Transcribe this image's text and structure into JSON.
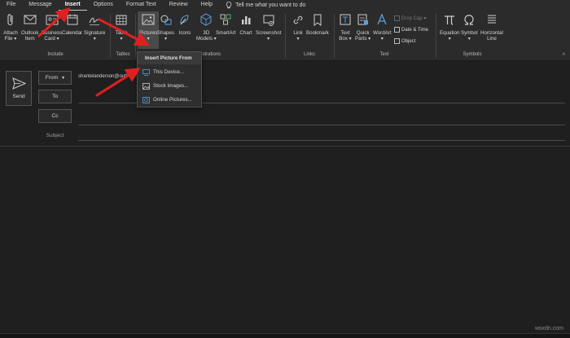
{
  "menu": {
    "tabs": [
      "File",
      "Message",
      "Insert",
      "Options",
      "Format Text",
      "Review",
      "Help"
    ],
    "active_tab": "Insert",
    "tell_me": "Tell me what you want to do"
  },
  "ribbon": {
    "attach_file": [
      "Attach",
      "File ▾"
    ],
    "outlook_item": [
      "Outlook",
      "Item"
    ],
    "business_card": [
      "Business",
      "Card ▾"
    ],
    "calendar": "Calendar",
    "signature": [
      "Signature",
      "▾"
    ],
    "table": [
      "Table",
      "▾"
    ],
    "pictures": [
      "Pictures",
      "▾"
    ],
    "shapes": [
      "Shapes",
      "▾"
    ],
    "icons": "Icons",
    "models_3d": [
      "3D",
      "Models ▾"
    ],
    "smartart": "SmartArt",
    "chart": "Chart",
    "screenshot": [
      "Screenshot",
      "▾"
    ],
    "link": [
      "Link",
      "▾"
    ],
    "bookmark": "Bookmark",
    "text_box": [
      "Text",
      "Box ▾"
    ],
    "quick_parts": [
      "Quick",
      "Parts ▾"
    ],
    "wordart": [
      "WordArt",
      "▾"
    ],
    "drop_cap": "Drop Cap ▾",
    "date_time": "Date & Time",
    "object": "Object",
    "equation": [
      "Equation",
      "▾"
    ],
    "symbol": [
      "Symbol",
      "▾"
    ],
    "horizontal_line": [
      "Horizontal",
      "Line"
    ],
    "groups": {
      "include": "Include",
      "tables": "Tables",
      "illustrations": "Illustrations",
      "links": "Links",
      "text": "Text",
      "symbols": "Symbols"
    }
  },
  "dropdown": {
    "header": "Insert Picture From",
    "items": [
      "This Device...",
      "Stock Images...",
      "Online Pictures..."
    ]
  },
  "compose": {
    "send": "Send",
    "from": "From",
    "from_address": "shantelanderson@outl",
    "to": "To",
    "cc": "Cc",
    "subject": "Subject"
  },
  "watermark": "wsxdn.com",
  "colors": {
    "annotation_arrow": "#e02020",
    "background": "#1f1f1f",
    "ribbon": "#2b2b2b"
  }
}
